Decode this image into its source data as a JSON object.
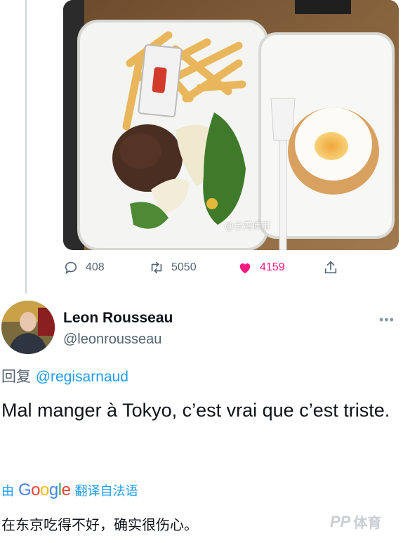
{
  "media": {
    "watermark": "@台湾债事"
  },
  "actions": {
    "reply_count": "408",
    "retweet_count": "5050",
    "like_count": "4159",
    "liked": true,
    "like_color": "#f91880"
  },
  "tweet": {
    "author_name": "Leon Rousseau",
    "author_handle": "@leonrousseau",
    "reply_prefix": "回复",
    "reply_to": "@regisarnaud",
    "text": "Mal manger à Tokyo, c’est vrai que c’est triste.",
    "translate_by": "由",
    "translate_provider": "Google",
    "translate_from": "翻译自法语",
    "translated_text": "在东京吃得不好，确实很伤心。"
  },
  "brand": {
    "logo": "PP",
    "label": "体育"
  },
  "colors": {
    "link": "#1d9bf0",
    "secondary": "#536471"
  }
}
